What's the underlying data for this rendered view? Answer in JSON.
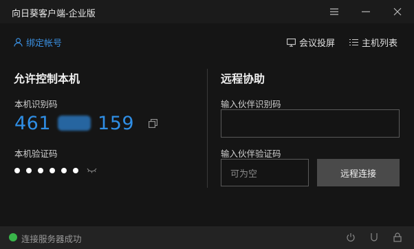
{
  "window": {
    "title": "向日葵客户端-企业版"
  },
  "toolbar": {
    "bind_account": "绑定帐号",
    "meeting_cast": "会议投屏",
    "host_list": "主机列表"
  },
  "left_panel": {
    "heading": "允许控制本机",
    "id_label": "本机识别码",
    "id_prefix": "461",
    "id_suffix": "159",
    "code_label": "本机验证码",
    "masked_dots": 6
  },
  "right_panel": {
    "heading": "远程协助",
    "partner_id_label": "输入伙伴识别码",
    "partner_id_value": "",
    "partner_code_label": "输入伙伴验证码",
    "partner_code_placeholder": "可为空",
    "connect_button": "远程连接"
  },
  "status": {
    "text": "连接服务器成功",
    "color": "#39b54a"
  },
  "colors": {
    "accent": "#2f8ee5",
    "background": "#151515"
  }
}
